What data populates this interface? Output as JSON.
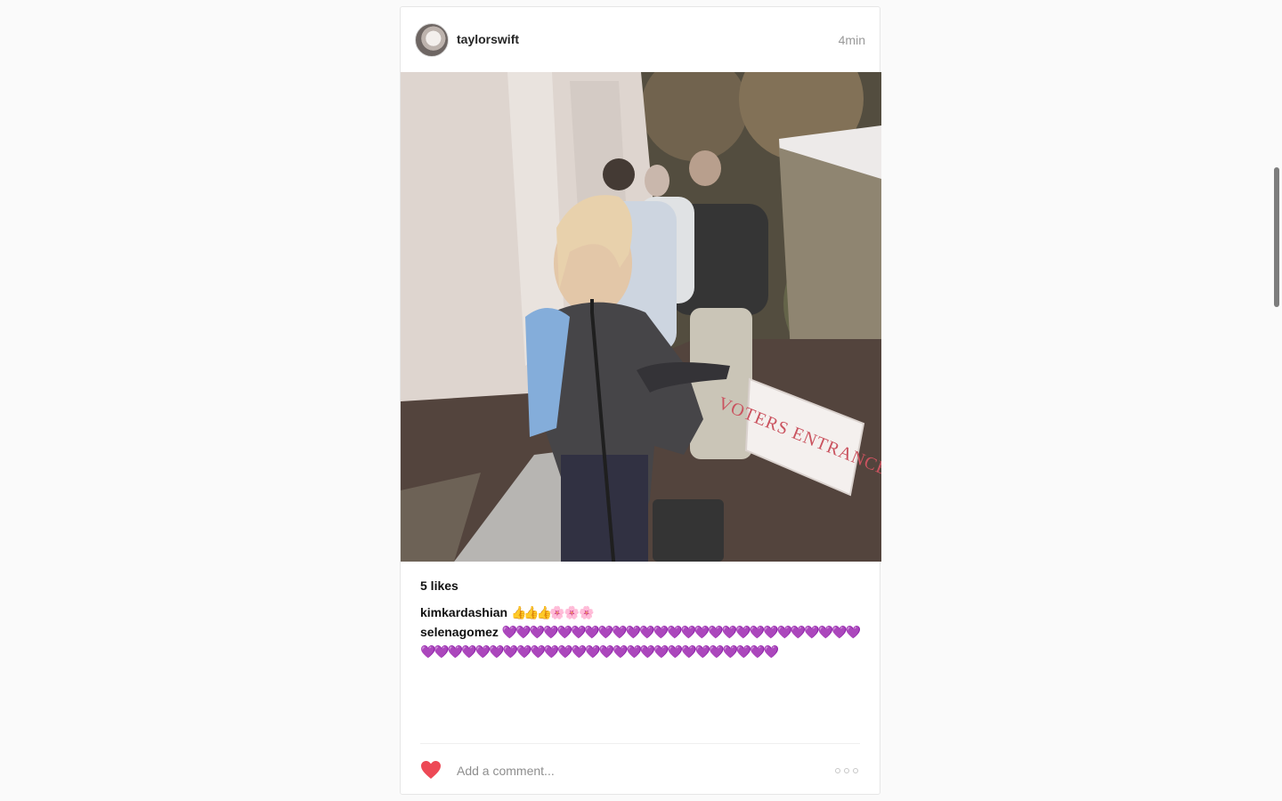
{
  "post": {
    "username": "taylorswift",
    "timestamp": "4min",
    "likes": "5 likes",
    "sign_text": "VOTERS ENTRANCE",
    "comments": [
      {
        "user": "kimkardashian",
        "text_a": "👍👍👍",
        "text_b": "🌸🌸🌸"
      },
      {
        "user": "selenagomez",
        "text": "💜💜💜💜💜💜💜💜💜💜💜💜💜💜💜💜💜💜💜💜💜💜💜💜💜💜💜💜💜💜💜💜💜💜💜💜💜💜💜💜💜💜💜💜💜💜💜💜💜💜💜💜"
      }
    ],
    "comment_placeholder": "Add a comment...",
    "icons": {
      "like": "heart-icon",
      "more": "more-options-icon"
    }
  },
  "colors": {
    "background": "#fafafa",
    "heart": "#ed4956",
    "card_border": "#e6e6e6"
  }
}
